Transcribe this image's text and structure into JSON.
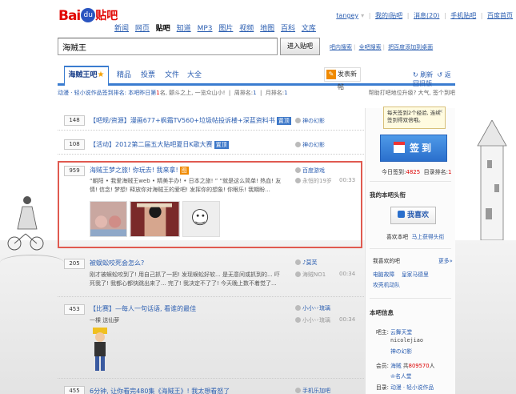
{
  "header": {
    "logo_text": "Bai",
    "logo_paw": "du",
    "logo_tieba": "贴吧",
    "nav": [
      "新闻",
      "网页",
      "贴吧",
      "知道",
      "MP3",
      "图片",
      "视频",
      "地图",
      "百科",
      "文库"
    ],
    "nav_current_index": 2,
    "user": {
      "name": "tangey",
      "links": [
        "我的i贴吧",
        "消息(20)",
        "手机贴吧",
        "百度首页"
      ],
      "message_count": "(20)"
    }
  },
  "search": {
    "value": "海贼王",
    "button": "进入贴吧",
    "links": [
      "吧内搜索",
      "全吧搜索",
      "把百度添加到桌面"
    ]
  },
  "tabs": {
    "active": "海贼王吧",
    "items": [
      "精品",
      "投票",
      "文件",
      "大全"
    ],
    "post_button": "发表新帖",
    "refresh": "刷新",
    "back": "返回旧版"
  },
  "infobar": {
    "prefix": "动漫 · 轻小说作品签到排名: 本吧昨日第",
    "rank": "1",
    "mid": "名, 颤斗之上, 一览众山小!",
    "week": "周排名:",
    "week_val": "1",
    "month": "月排名:",
    "month_val": "1",
    "right": "帮助打吧地位升级? 大气, 签个到吧"
  },
  "threads": [
    {
      "count": "148",
      "title": "【吧规/资源】漫画677+枫霜TV560+垃圾帖投诉楼+深蓝资料书",
      "badge": "置顶",
      "author": "神の幻影"
    },
    {
      "count": "108",
      "title": "【活动】2012第二届五大贴吧夏日K歌大赛",
      "badge": "置顶",
      "author": "神の幻影"
    },
    {
      "count": "959",
      "title": "海贼王梦之旅! 你玩去! 我来拿!",
      "badge": "图",
      "author": "百度游戏",
      "reply": "永恒的19岁",
      "time": "00:33",
      "desc": "“朝阳 • 我爱海贼王web • 精美手办! • 日本之旅! ” “就是这么简单! 热血! 友情! 信念! 梦想! 释放你对海贼王的爱吧! 发挥你的想象! 你眼乐! 我期盼..."
    },
    {
      "count": "205",
      "title": "被蜈蚣咬死会怎么?",
      "author": "♪莫芙",
      "reply": "海贼NO1",
      "time": "00:34",
      "desc": "刚才被蜈蚣咬到了! 用自己抓了一把! 发现蜈蚣好软... 是无意间或抓到的... 吓死我了! 我都心都快跳出来了... 完了! 我决定不了了! 今天晚上数不着觉了..."
    },
    {
      "count": "453",
      "title": "【比赛】—每人一句话语, 看谁的最佳",
      "author": "小小丷琉璃",
      "reply": "小小丷琉璃",
      "time": "00:34",
      "desc": "一棵 送仙萝"
    },
    {
      "count": "455",
      "title": "6分钟, 让你看完480集《海贼王》! 我太想看怒了",
      "author": "手机乐加吧",
      "time": ""
    }
  ],
  "sidebar": {
    "tooltip": "每天签到2个经验, 连续签到得双倍哦。",
    "tooltip_close": "×",
    "sign_label": "签到",
    "today_label": "今日签到:",
    "today_val": "4825",
    "rank_label": "目录排名:",
    "rank_val": "1",
    "my_head_title": "我的本吧头衔",
    "like_button": "我喜欢",
    "like_hint_a": "喜欢本吧",
    "like_hint_b": "马上获得头衔",
    "fav_title": "我喜欢的吧",
    "more": "更多»",
    "fav_bars": [
      "电脑故障",
      "皇家马德里",
      "攻壳机动队"
    ],
    "info_title": "本吧信息",
    "owner_label": "吧主:",
    "owners": [
      "云舞天堂",
      "nicolejiao",
      "神の幻影"
    ],
    "members_label": "会员:",
    "members_name": "海贼",
    "members_prefix": "共",
    "members_count": "809570",
    "members_suffix": "人",
    "member_link": "名人堂",
    "dir_label": "目录:",
    "dir_value": "动漫 · 轻小说作品"
  }
}
